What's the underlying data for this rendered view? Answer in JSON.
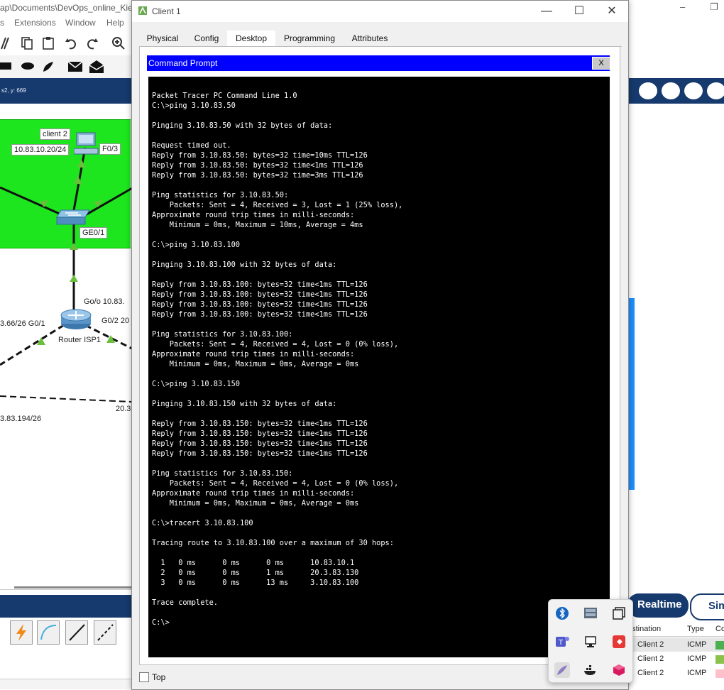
{
  "background_app": {
    "title_path": "ap\\Documents\\DevOps_online_Kie",
    "menu": [
      "s",
      "Extensions",
      "Window",
      "Help"
    ],
    "coordinates": "s2, y: 669",
    "window_controls": [
      "–",
      "❐"
    ],
    "topology": {
      "client2_label": "client 2",
      "client2_ip": "10.83.10.20/24",
      "switch_port": "F0/3",
      "uplink_port": "GE0/1",
      "router_name": "Router ISP1",
      "router_port_go": "Go/o 10.83.",
      "router_port_g02": "G0/2 20",
      "left_link_label": "3.66/26  G0/1",
      "bottom_left_label": "3.83.194/26",
      "bottom_right_label": "20.3"
    },
    "mode_buttons": {
      "realtime": "Realtime",
      "simulation": "Sim"
    },
    "event_table": {
      "headers": [
        "estination",
        "Type",
        "Co"
      ],
      "rows": [
        {
          "destination": "Client 2",
          "type": "ICMP",
          "color": "#4caf50"
        },
        {
          "destination": "Client 2",
          "type": "ICMP",
          "color": "#8bc34a"
        },
        {
          "destination": "Client 2",
          "type": "ICMP",
          "color": "#ffc0cb"
        }
      ]
    }
  },
  "dialog": {
    "title": "Client 1",
    "controls": {
      "minimize": "—",
      "maximize": "☐",
      "close": "✕"
    },
    "tabs": [
      {
        "label": "Physical"
      },
      {
        "label": "Config"
      },
      {
        "label": "Desktop",
        "active": true
      },
      {
        "label": "Programming"
      },
      {
        "label": "Attributes"
      }
    ],
    "command_prompt": {
      "title": "Command Prompt",
      "close_label": "X",
      "output": "Packet Tracer PC Command Line 1.0\nC:\\>ping 3.10.83.50\n\nPinging 3.10.83.50 with 32 bytes of data:\n\nRequest timed out.\nReply from 3.10.83.50: bytes=32 time=10ms TTL=126\nReply from 3.10.83.50: bytes=32 time<1ms TTL=126\nReply from 3.10.83.50: bytes=32 time=3ms TTL=126\n\nPing statistics for 3.10.83.50:\n    Packets: Sent = 4, Received = 3, Lost = 1 (25% loss),\nApproximate round trip times in milli-seconds:\n    Minimum = 0ms, Maximum = 10ms, Average = 4ms\n\nC:\\>ping 3.10.83.100\n\nPinging 3.10.83.100 with 32 bytes of data:\n\nReply from 3.10.83.100: bytes=32 time<1ms TTL=126\nReply from 3.10.83.100: bytes=32 time<1ms TTL=126\nReply from 3.10.83.100: bytes=32 time<1ms TTL=126\nReply from 3.10.83.100: bytes=32 time<1ms TTL=126\n\nPing statistics for 3.10.83.100:\n    Packets: Sent = 4, Received = 4, Lost = 0 (0% loss),\nApproximate round trip times in milli-seconds:\n    Minimum = 0ms, Maximum = 0ms, Average = 0ms\n\nC:\\>ping 3.10.83.150\n\nPinging 3.10.83.150 with 32 bytes of data:\n\nReply from 3.10.83.150: bytes=32 time<1ms TTL=126\nReply from 3.10.83.150: bytes=32 time<1ms TTL=126\nReply from 3.10.83.150: bytes=32 time<1ms TTL=126\nReply from 3.10.83.150: bytes=32 time<1ms TTL=126\n\nPing statistics for 3.10.83.150:\n    Packets: Sent = 4, Received = 4, Lost = 0 (0% loss),\nApproximate round trip times in milli-seconds:\n    Minimum = 0ms, Maximum = 0ms, Average = 0ms\n\nC:\\>tracert 3.10.83.100\n\nTracing route to 3.10.83.100 over a maximum of 30 hops:\n\n  1   0 ms      0 ms      0 ms      10.83.10.1\n  2   0 ms      0 ms      1 ms      20.3.83.130\n  3   0 ms      0 ms      13 ms     3.10.83.100\n\nTrace complete.\n\nC:\\>"
    },
    "top_checkbox_label": "Top"
  },
  "tray_icons": [
    "bluetooth-icon",
    "hardware-monitor-icon",
    "copy-windows-icon",
    "teams-icon",
    "network-display-icon",
    "red-app-icon",
    "feather-icon",
    "docker-icon",
    "cube-app-icon"
  ]
}
